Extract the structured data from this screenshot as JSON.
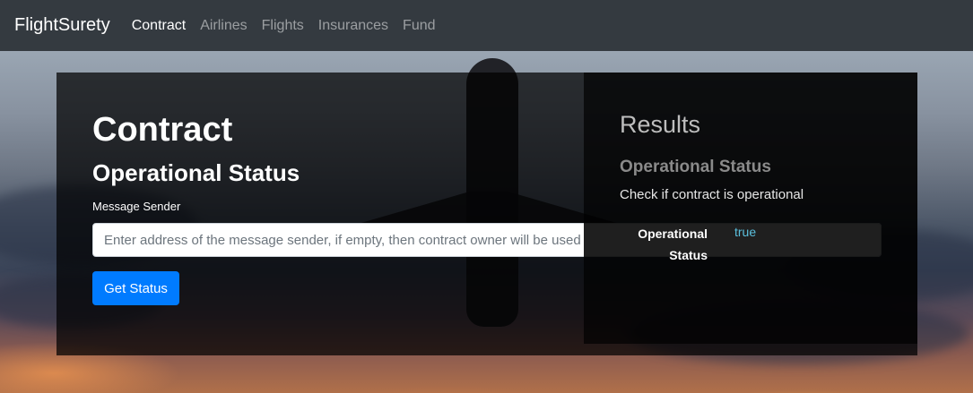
{
  "navbar": {
    "brand": "FlightSurety",
    "links": [
      {
        "label": "Contract",
        "active": true
      },
      {
        "label": "Airlines",
        "active": false
      },
      {
        "label": "Flights",
        "active": false
      },
      {
        "label": "Insurances",
        "active": false
      },
      {
        "label": "Fund",
        "active": false
      }
    ]
  },
  "contract": {
    "title": "Contract",
    "section_title": "Operational Status",
    "field_label": "Message Sender",
    "input_value": "",
    "input_placeholder": "Enter address of the message sender, if empty, then contract owner will be used",
    "button_label": "Get Status"
  },
  "results": {
    "title": "Results",
    "section_title": "Operational Status",
    "description": "Check if contract is operational",
    "rows": [
      {
        "key": "Operational Status",
        "value": "true"
      }
    ]
  },
  "colors": {
    "navbar_bg": "#343a40",
    "primary_button": "#007bff",
    "result_value": "#5bc0de"
  }
}
